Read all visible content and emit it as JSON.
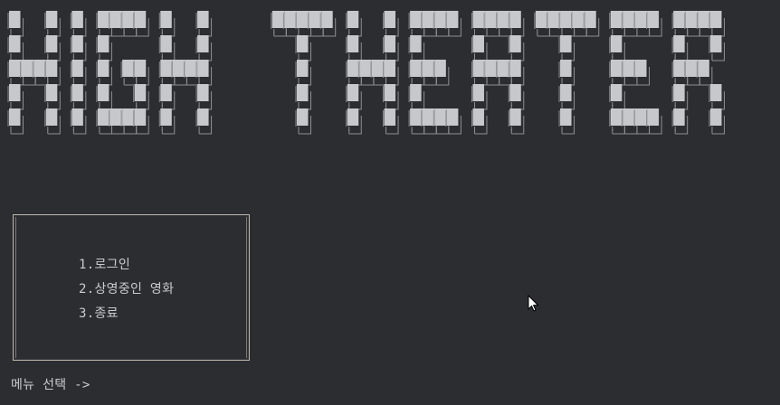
{
  "banner": {
    "text": "HIGH THEATER",
    "block_color": "#c7c8cc",
    "frame_color": "#8d8f95"
  },
  "menu": {
    "items": [
      {
        "label": "1.로그인"
      },
      {
        "label": "2.상영중인 영화"
      },
      {
        "label": "3.종료"
      }
    ]
  },
  "prompt": {
    "text": "메뉴 선택 ->"
  },
  "colors": {
    "background": "#2b2d31",
    "text": "#c9cbcf",
    "box_border": "#b9b4a8"
  },
  "cursor": {
    "icon": "mouse-pointer-icon"
  }
}
